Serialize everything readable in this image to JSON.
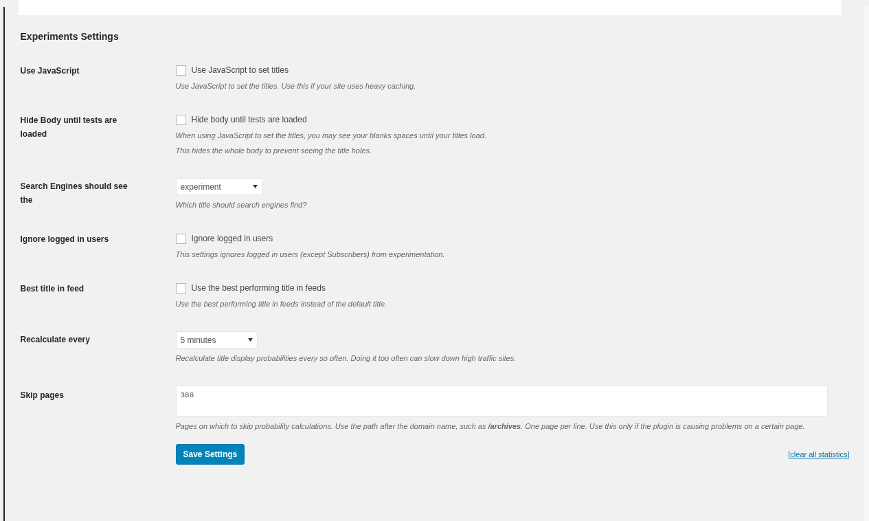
{
  "section_title": "Experiments Settings",
  "rows": [
    {
      "label": "Use JavaScript",
      "kind": "checkbox",
      "checked": false,
      "option": "Use JavaScript to set titles",
      "description": [
        "Use JavaScript to set the titles. Use this if your site uses heavy caching."
      ]
    },
    {
      "label": "Hide Body until tests are loaded",
      "kind": "checkbox",
      "checked": false,
      "option": "Hide body until tests are loaded",
      "description": [
        "When using JavaScript to set the titles, you may see your blanks spaces until your titles load.",
        "This hides the whole body to prevent seeing the title holes."
      ]
    },
    {
      "label": "Search Engines should see the",
      "kind": "select",
      "value": "experiment",
      "description": [
        "Which title should search engines find?"
      ]
    },
    {
      "label": "Ignore logged in users",
      "kind": "checkbox",
      "checked": false,
      "option": "Ignore logged in users",
      "description": [
        "This settings ignores logged in users (except Subscribers) from experimentation."
      ]
    },
    {
      "label": "Best title in feed",
      "kind": "checkbox",
      "checked": false,
      "option": "Use the best performing title in feeds",
      "description": [
        "Use the best performing title in feeds instead of the default title."
      ]
    },
    {
      "label": "Recalculate every",
      "kind": "select",
      "value": "5 minutes",
      "description": [
        "Recalculate title display probabilities every so often. Doing it too often can slow down high traffic sites."
      ]
    },
    {
      "label": "Skip pages",
      "kind": "textarea",
      "value": "388",
      "description": [
        "Pages on which to skip probability calculations. Use the path after the domain name, such as **/archives**. One page per line. Use this only if the plugin is causing problems on a certain page."
      ]
    }
  ],
  "save_button": "Save Settings",
  "clear_link": "[clear all statistics]"
}
